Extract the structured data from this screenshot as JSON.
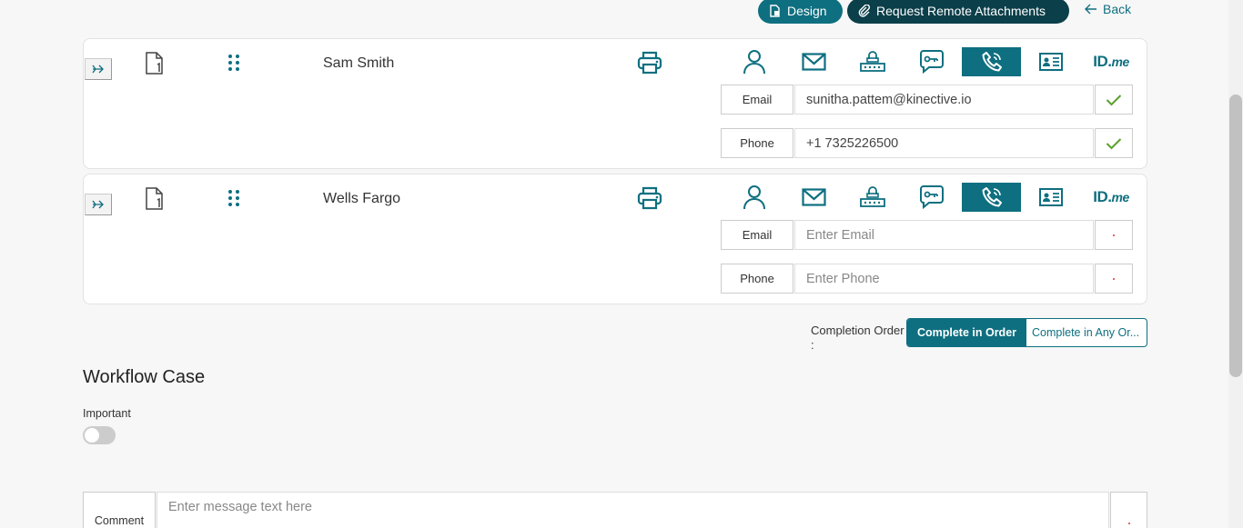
{
  "toolbar": {
    "design_label": "Design",
    "request_label": "Request Remote Attachments",
    "back_label": "Back"
  },
  "signers": [
    {
      "name": "Sam Smith",
      "email_label": "Email",
      "email_value": "sunitha.pattem@kinective.io",
      "email_placeholder": "Enter Email",
      "phone_label": "Phone",
      "phone_value": "+1 7325226500",
      "phone_placeholder": "Enter Phone"
    },
    {
      "name": "Wells Fargo",
      "email_label": "Email",
      "email_value": "",
      "email_placeholder": "Enter Email",
      "phone_label": "Phone",
      "phone_value": "",
      "phone_placeholder": "Enter Phone"
    }
  ],
  "auth_methods": [
    "person-icon",
    "mail-icon",
    "router-icon",
    "chat-key-icon",
    "phone-icon",
    "id-card-icon",
    "idme-logo"
  ],
  "auth_active": "phone-icon",
  "idme": {
    "main": "ID.",
    "sub": "me"
  },
  "completion": {
    "label": "Completion Order",
    "colon": ":",
    "option_in_order": "Complete in Order",
    "option_any_order": "Complete in Any Or..."
  },
  "workflow": {
    "title": "Workflow Case",
    "important_label": "Important",
    "important_on": false,
    "comment_label": "Comment",
    "comment_placeholder": "Enter message text here"
  },
  "colors": {
    "primary": "#0e6f80",
    "dark": "#0b3f4a",
    "success": "#5aa02c",
    "required": "#d33333"
  }
}
